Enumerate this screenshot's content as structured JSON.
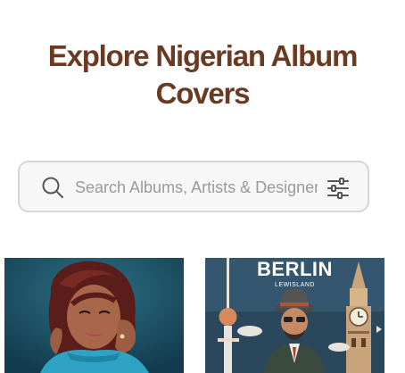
{
  "page": {
    "title_line1": "Explore Nigerian Album",
    "title_line2": "Covers"
  },
  "search": {
    "placeholder": "Search Albums, Artists & Designers",
    "icon": "search-icon",
    "filter_icon": "filter-icon"
  },
  "albums": [
    {
      "cover": "woman-portrait-teal-background"
    },
    {
      "cover": "berlin-illustration",
      "title": "BERLIN",
      "subtitle": "LEWISLAND"
    }
  ],
  "colors": {
    "title": "#6a3a22",
    "search_border": "#d6d6d6",
    "search_bg": "#f7f7f7",
    "placeholder": "#9a9a9a"
  }
}
